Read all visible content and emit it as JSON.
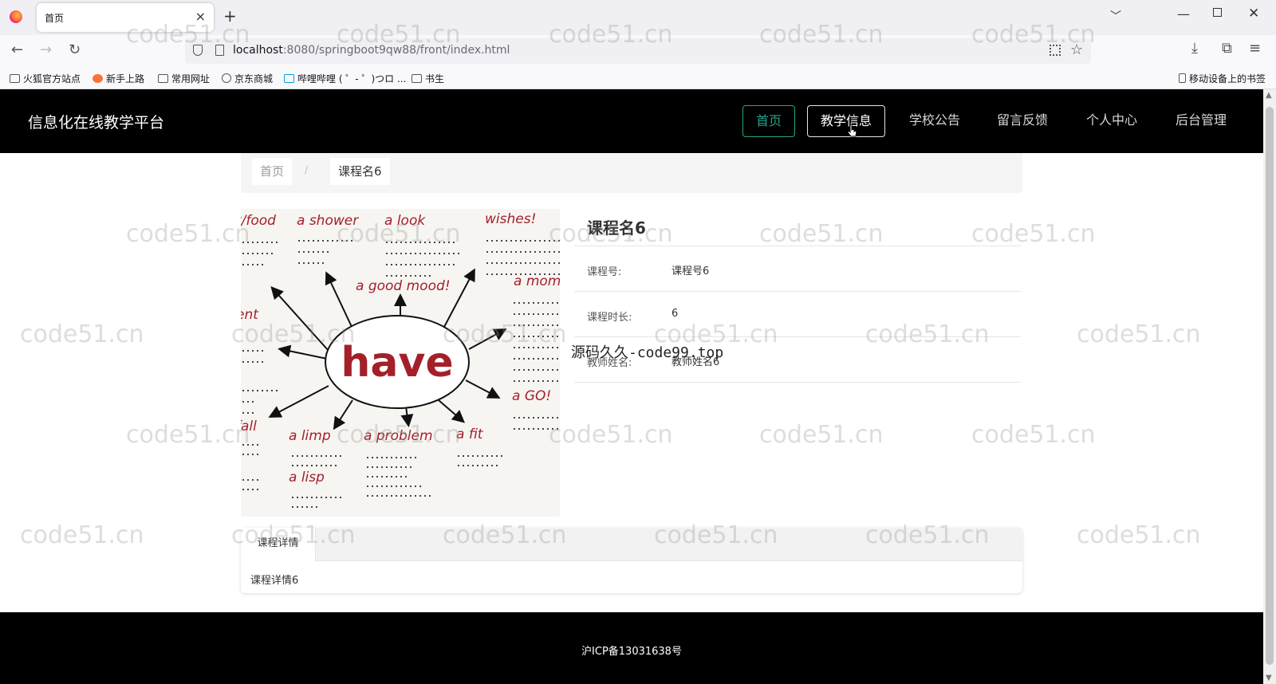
{
  "browser": {
    "tab_title": "首页",
    "tab_close": "×",
    "new_tab": "+",
    "url_host": "localhost",
    "url_rest": ":8080/springboot9qw88/front/index.html",
    "bookmarks": [
      "火狐官方站点",
      "新手上路",
      "常用网址",
      "京东商城",
      "哔哩哔哩 ( ゜- ゜)つロ ...",
      "书生"
    ],
    "mobile_bookmarks": "移动设备上的书签"
  },
  "site": {
    "title": "信息化在线教学平台",
    "menu": [
      "首页",
      "教学信息",
      "学校公告",
      "留言反馈",
      "个人中心",
      "后台管理"
    ],
    "breadcrumb": {
      "home": "首页",
      "sep": "/",
      "current": "课程名6"
    },
    "course": {
      "name": "课程名6",
      "fields": [
        {
          "label": "课程号:",
          "value": "课程号6"
        },
        {
          "label": "课程时长:",
          "value": "6"
        },
        {
          "label": "教师姓名:",
          "value": "教师姓名6"
        }
      ],
      "tab_label": "课程详情",
      "tab_content": "课程详情6"
    },
    "footer_icp": "沪ICP备13031638号"
  },
  "overlay_text": "源码久久-code99.top",
  "watermark": "code51.cn",
  "image_words": {
    "center": "have",
    "shower": "a shower",
    "look": "a look",
    "wishes": "wishes!",
    "food": "t/food",
    "mood": "a good mood!",
    "moment": "a mom",
    "ent": "ent",
    "go": "a GO!",
    "fall": "fall",
    "limp": "a limp",
    "problem": "a problem",
    "fit": "a fit",
    "lisp": "a lisp"
  },
  "colors": {
    "accent": "#25a38a",
    "header_bg": "#000000",
    "have_red": "#a3202b"
  }
}
